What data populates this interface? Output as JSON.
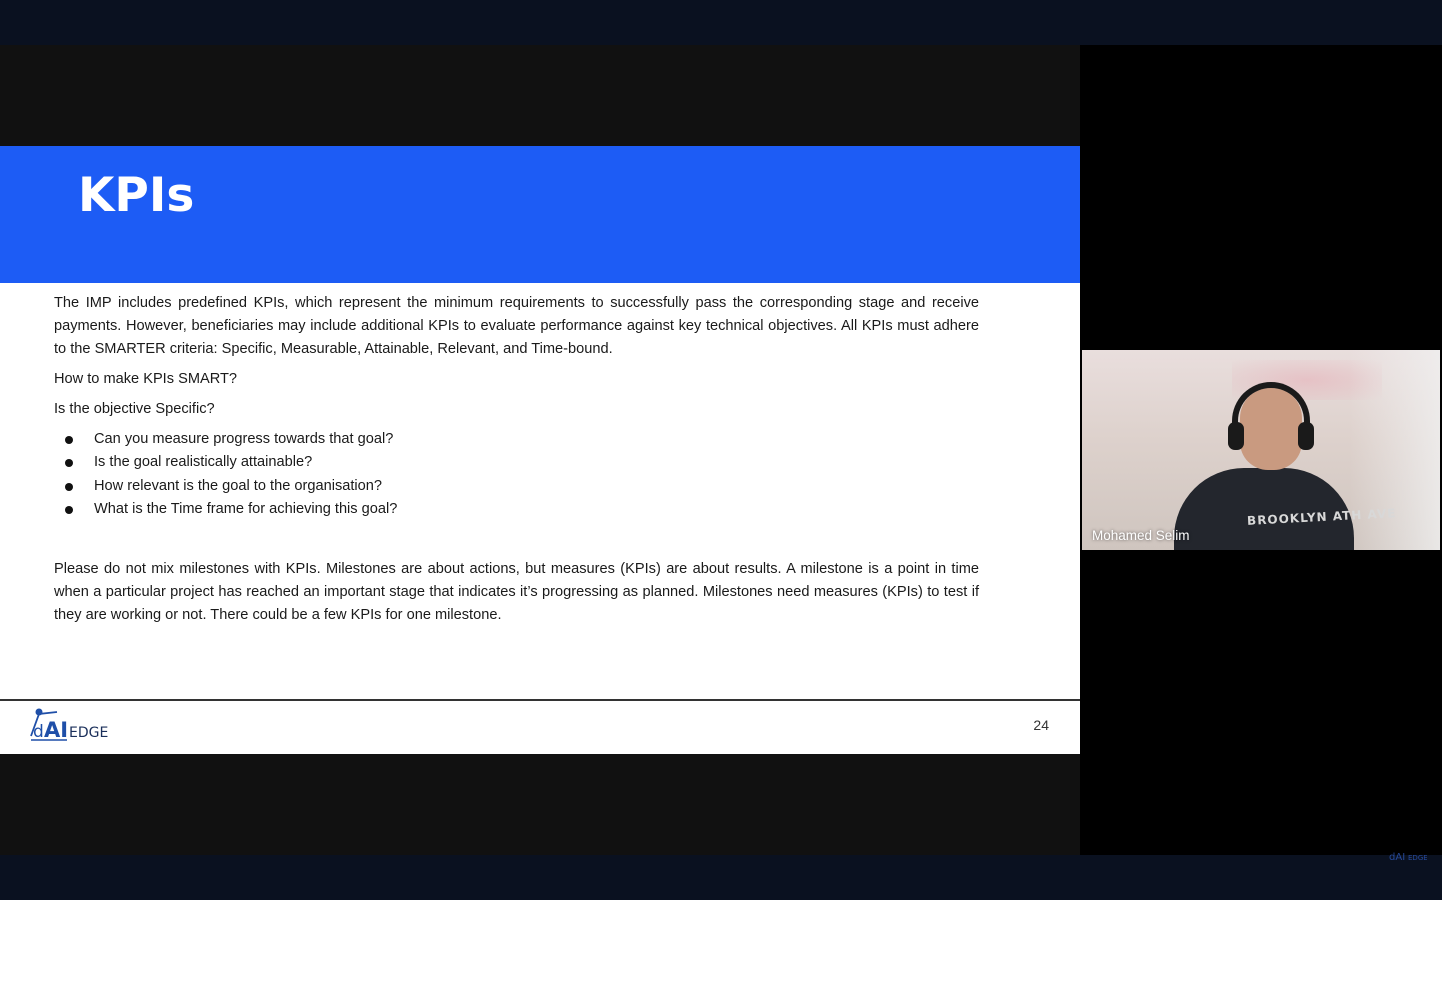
{
  "slide": {
    "title": "KPIs",
    "paragraph1": "The IMP includes predefined KPIs, which represent the minimum requirements to successfully pass the corresponding stage and receive payments. However, beneficiaries may include additional KPIs to evaluate performance against key technical objectives. All KPIs must adhere to the SMARTER criteria: Specific, Measurable, Attainable, Relevant, and Time-bound.",
    "question1": "How to make KPIs SMART?",
    "question2": "Is the objective Specific?",
    "bullets": [
      "Can you measure progress towards that goal?",
      "Is the goal realistically attainable?",
      "How relevant is the goal to the organisation?",
      "What is the Time frame for achieving this goal?"
    ],
    "paragraph2": "Please do not mix milestones with KPIs. Milestones are about actions, but measures (KPIs) are about results. A milestone is a point in time when a particular project has reached an important stage that indicates it’s progressing as planned. Milestones need measures (KPIs) to test if they are working or not. There could be a few KPIs for one milestone.",
    "page_number": "24",
    "logo_text": "dAIEDGE"
  },
  "video": {
    "participant_name": "Mohamed Selim",
    "hoodie_text": "BROOKLYN ATH AVE"
  },
  "colors": {
    "header_blue": "#1d5cf5",
    "logo_blue": "#1f4fa8",
    "frame_dark": "#0a1120"
  }
}
